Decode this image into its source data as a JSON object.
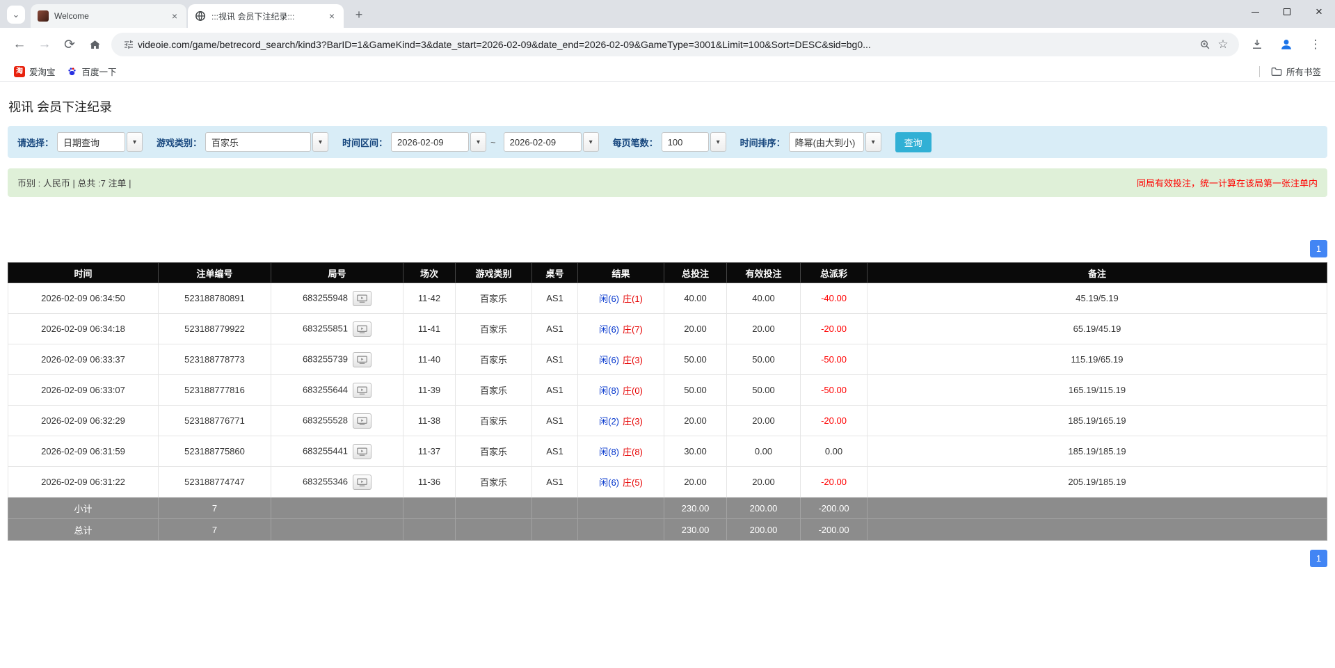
{
  "browser": {
    "tabs": [
      {
        "title": "Welcome"
      },
      {
        "title": ":::视讯 会员下注纪录:::"
      }
    ],
    "url": "videoie.com/game/betrecord_search/kind3?BarID=1&GameKind=3&date_start=2026-02-09&date_end=2026-02-09&GameType=3001&Limit=100&Sort=DESC&sid=bg0...",
    "bookmarks": [
      {
        "label": "爱淘宝"
      },
      {
        "label": "百度一下"
      }
    ],
    "all_bookmarks_label": "所有书签"
  },
  "icons": {
    "tab_search": "⌄",
    "close_tab": "×",
    "new_tab": "+",
    "minimize": "minimize",
    "maximize": "maximize",
    "close_window": "×",
    "back": "←",
    "forward": "→",
    "reload": "⟳",
    "star": "☆",
    "kebab_menu": "⋮",
    "combo_arrow": "▾",
    "taobao_glyph": "淘"
  },
  "colors": {
    "filter_bar_bg": "#d9edf7",
    "summary_bar_bg": "#dff0d8",
    "search_button": "#31b0d5",
    "pagination_blue": "#4285f4",
    "link_blue": "#337ab7",
    "player_blue": "#0033cc",
    "banker_red": "#e60000",
    "negative_red": "#ff0000",
    "header_black": "#0a0a0a",
    "footer_gray": "#8c8c8c"
  },
  "page": {
    "title": "视讯 会员下注纪录",
    "filters": {
      "select_label": "请选择：",
      "select_value": "日期查询",
      "game_kind_label": "游戏类别：",
      "game_kind_value": "百家乐",
      "date_range_label": "时间区间：",
      "date_start": "2026-02-09",
      "date_tilde": "~",
      "date_end": "2026-02-09",
      "per_page_label": "每页笔数：",
      "per_page_value": "100",
      "sort_label": "时间排序：",
      "sort_value": "降幂(由大到小)",
      "search_button": "查询"
    },
    "summary": {
      "left": "币别 : 人民币 | 总共 :7 注单 |",
      "right": "同局有效投注，统一计算在该局第一张注单内"
    },
    "pagination": {
      "page": "1"
    },
    "table": {
      "headers": [
        "时间",
        "注单编号",
        "局号",
        "场次",
        "游戏类别",
        "桌号",
        "结果",
        "总投注",
        "有效投注",
        "总派彩",
        "备注"
      ],
      "rows": [
        {
          "time": "2026-02-09 06:34:50",
          "bet_id": "523188780891",
          "round": "683255948",
          "session": "11-42",
          "game": "百家乐",
          "table_no": "AS1",
          "result_player": "闲(6)",
          "result_banker": "庄(1)",
          "total_bet": "40.00",
          "valid_bet": "40.00",
          "payout": "-40.00",
          "remark": "45.19/5.19"
        },
        {
          "time": "2026-02-09 06:34:18",
          "bet_id": "523188779922",
          "round": "683255851",
          "session": "11-41",
          "game": "百家乐",
          "table_no": "AS1",
          "result_player": "闲(6)",
          "result_banker": "庄(7)",
          "total_bet": "20.00",
          "valid_bet": "20.00",
          "payout": "-20.00",
          "remark": "65.19/45.19"
        },
        {
          "time": "2026-02-09 06:33:37",
          "bet_id": "523188778773",
          "round": "683255739",
          "session": "11-40",
          "game": "百家乐",
          "table_no": "AS1",
          "result_player": "闲(6)",
          "result_banker": "庄(3)",
          "total_bet": "50.00",
          "valid_bet": "50.00",
          "payout": "-50.00",
          "remark": "115.19/65.19"
        },
        {
          "time": "2026-02-09 06:33:07",
          "bet_id": "523188777816",
          "round": "683255644",
          "session": "11-39",
          "game": "百家乐",
          "table_no": "AS1",
          "result_player": "闲(8)",
          "result_banker": "庄(0)",
          "total_bet": "50.00",
          "valid_bet": "50.00",
          "payout": "-50.00",
          "remark": "165.19/115.19"
        },
        {
          "time": "2026-02-09 06:32:29",
          "bet_id": "523188776771",
          "round": "683255528",
          "session": "11-38",
          "game": "百家乐",
          "table_no": "AS1",
          "result_player": "闲(2)",
          "result_banker": "庄(3)",
          "total_bet": "20.00",
          "valid_bet": "20.00",
          "payout": "-20.00",
          "remark": "185.19/165.19"
        },
        {
          "time": "2026-02-09 06:31:59",
          "bet_id": "523188775860",
          "round": "683255441",
          "session": "11-37",
          "game": "百家乐",
          "table_no": "AS1",
          "result_player": "闲(8)",
          "result_banker": "庄(8)",
          "total_bet": "30.00",
          "valid_bet": "0.00",
          "payout": "0.00",
          "remark": "185.19/185.19"
        },
        {
          "time": "2026-02-09 06:31:22",
          "bet_id": "523188774747",
          "round": "683255346",
          "session": "11-36",
          "game": "百家乐",
          "table_no": "AS1",
          "result_player": "闲(6)",
          "result_banker": "庄(5)",
          "total_bet": "20.00",
          "valid_bet": "20.00",
          "payout": "-20.00",
          "remark": "205.19/185.19"
        }
      ],
      "subtotal": {
        "label": "小计",
        "count": "7",
        "total_bet": "230.00",
        "valid_bet": "200.00",
        "payout": "-200.00"
      },
      "total": {
        "label": "总计",
        "count": "7",
        "total_bet": "230.00",
        "valid_bet": "200.00",
        "payout": "-200.00"
      }
    }
  }
}
